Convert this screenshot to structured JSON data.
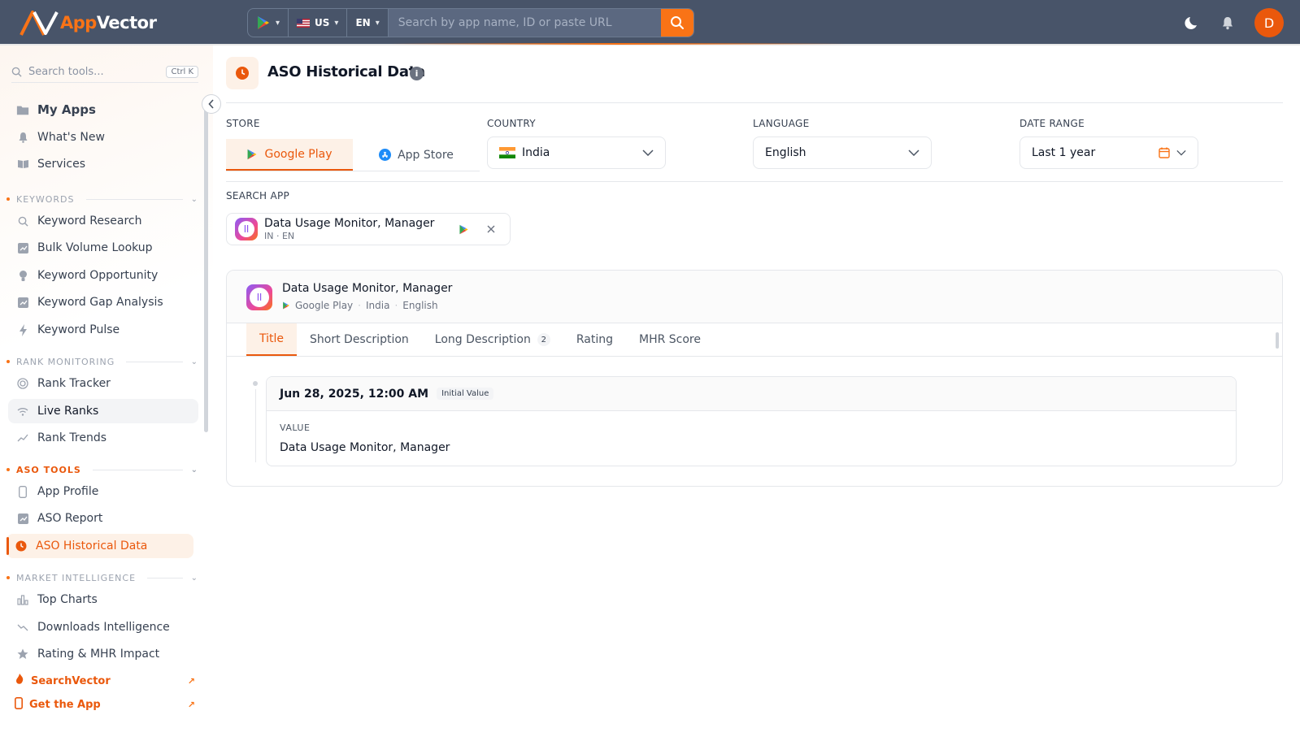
{
  "brand": {
    "name_part1": "App",
    "name_part2": "Vector"
  },
  "header": {
    "store_selector": "google-play",
    "country_code": "US",
    "language_code": "EN",
    "search_placeholder": "Search by app name, ID or paste URL",
    "avatar_initial": "D"
  },
  "sidebar": {
    "search_placeholder": "Search tools...",
    "search_shortcut": "Ctrl K",
    "top_items": [
      {
        "label": "My Apps",
        "icon": "folder-icon"
      },
      {
        "label": "What's New",
        "icon": "bell-icon"
      },
      {
        "label": "Services",
        "icon": "book-icon"
      }
    ],
    "sections": {
      "keywords": {
        "title": "KEYWORDS",
        "items": [
          "Keyword Research",
          "Bulk Volume Lookup",
          "Keyword Opportunity",
          "Keyword Gap Analysis",
          "Keyword Pulse"
        ]
      },
      "rank_monitoring": {
        "title": "RANK MONITORING",
        "items": [
          "Rank Tracker",
          "Live Ranks",
          "Rank Trends"
        ]
      },
      "aso_tools": {
        "title": "ASO TOOLS",
        "items": [
          "App Profile",
          "ASO Report",
          "ASO Historical Data"
        ]
      },
      "market_intelligence": {
        "title": "MARKET INTELLIGENCE",
        "items": [
          "Top Charts",
          "Downloads Intelligence",
          "Rating & MHR Impact"
        ]
      }
    },
    "footer_links": [
      "SearchVector",
      "Get the App"
    ]
  },
  "page": {
    "title": "ASO Historical Data",
    "store_label": "STORE",
    "store_tabs": [
      "Google Play",
      "App Store"
    ],
    "country_label": "COUNTRY",
    "country_value": "India",
    "language_label": "LANGUAGE",
    "language_value": "English",
    "date_range_label": "DATE RANGE",
    "date_range_value": "Last 1 year",
    "search_app_label": "SEARCH APP",
    "selected_app": {
      "name": "Data Usage Monitor, Manager",
      "sub": "IN · EN"
    }
  },
  "card": {
    "app_name": "Data Usage Monitor, Manager",
    "meta": [
      "Google Play",
      "India",
      "English"
    ],
    "tabs": [
      {
        "label": "Title",
        "badge": ""
      },
      {
        "label": "Short Description",
        "badge": ""
      },
      {
        "label": "Long Description",
        "badge": "2"
      },
      {
        "label": "Rating",
        "badge": ""
      },
      {
        "label": "MHR Score",
        "badge": ""
      }
    ],
    "entry": {
      "date": "Jun 28, 2025, 12:00 AM",
      "badge": "Initial Value",
      "value_label": "VALUE",
      "value": "Data Usage Monitor, Manager"
    }
  },
  "colors": {
    "accent": "#ea580c",
    "header_bg": "#485469"
  }
}
